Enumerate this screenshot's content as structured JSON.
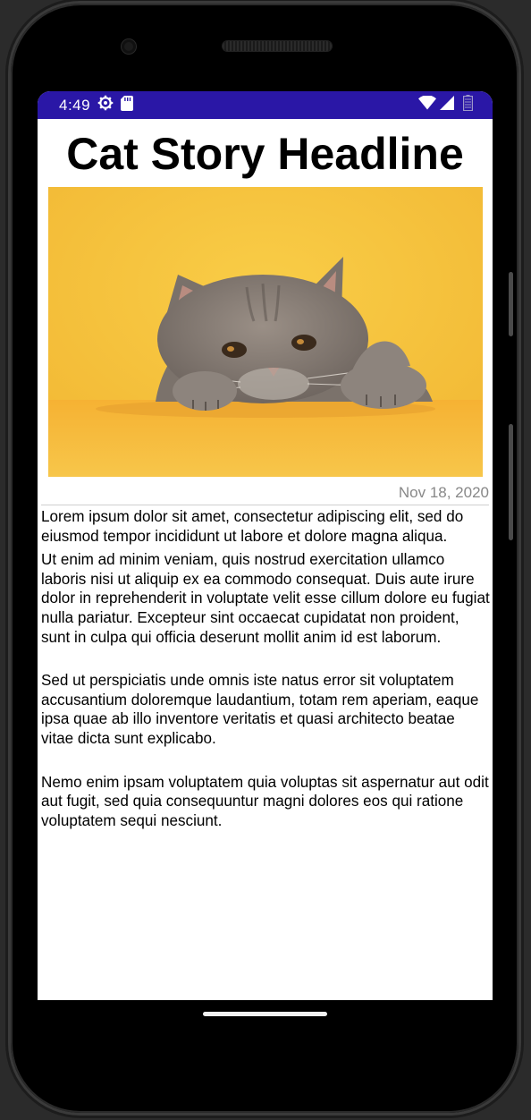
{
  "status_bar": {
    "time": "4:49",
    "background": "#2a17a6",
    "left_icons": [
      "settings-gear-icon",
      "sd-card-icon"
    ],
    "right_icons": [
      "wifi-icon",
      "cellular-signal-icon",
      "battery-icon"
    ]
  },
  "article": {
    "headline": "Cat Story Headline",
    "image": "gray-cat-peeking-over-table-yellow-background",
    "image_background": "#f5c23a",
    "date": "Nov 18, 2020",
    "paragraphs": [
      "Lorem ipsum dolor sit amet, consectetur adipiscing elit, sed do eiusmod tempor incididunt ut labore et dolore magna aliqua.",
      "Ut enim ad minim veniam, quis nostrud exercitation ullamco laboris nisi ut aliquip ex ea commodo consequat. Duis aute irure dolor in reprehenderit in voluptate velit esse cillum dolore eu fugiat nulla pariatur. Excepteur sint occaecat cupidatat non proident, sunt in culpa qui officia deserunt mollit anim id est laborum.",
      "Sed ut perspiciatis unde omnis iste natus error sit voluptatem accusantium doloremque laudantium, totam rem aperiam, eaque ipsa quae ab illo inventore veritatis et quasi architecto beatae vitae dicta sunt explicabo.",
      "Nemo enim ipsam voluptatem quia voluptas sit aspernatur aut odit aut fugit, sed quia consequuntur magni dolores eos qui ratione voluptatem sequi nesciunt."
    ]
  },
  "navigation": {
    "gesture_handle": "home-gesture-bar"
  }
}
